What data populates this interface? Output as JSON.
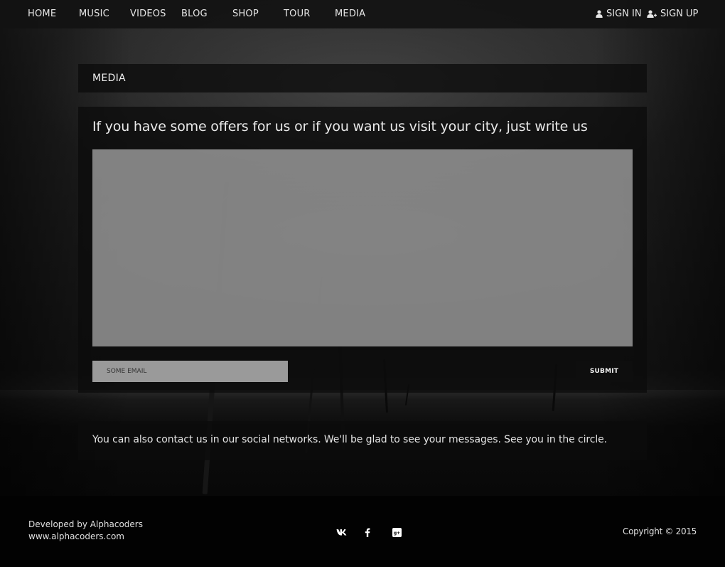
{
  "nav": {
    "items": [
      {
        "label": "HOME"
      },
      {
        "label": "MUSIC"
      },
      {
        "label": "VIDEOS"
      },
      {
        "label": "BLOG"
      },
      {
        "label": "SHOP"
      },
      {
        "label": "TOUR"
      },
      {
        "label": "MEDIA"
      }
    ],
    "sign_in": "SIGN IN",
    "sign_up": "SIGN UP",
    "sign_in_icon": "user-icon",
    "sign_up_icon": "user-plus-icon"
  },
  "section": {
    "title": "MEDIA"
  },
  "contact_form": {
    "heading": "If you have some offers for us or if you want us visit your city, just write us",
    "message_value": "",
    "email_placeholder": "SOME EMAIL",
    "submit_label": "SUBMIT"
  },
  "social_note": "You can also contact us in our social networks. We'll be glad to see your messages. See you in the circle.",
  "footer": {
    "developed_by": "Developed by Alphacoders",
    "url": "www.alphacoders.com",
    "social_icons": [
      "vk-icon",
      "facebook-icon",
      "google-plus-icon"
    ],
    "copyright": "Copyright © 2015"
  }
}
